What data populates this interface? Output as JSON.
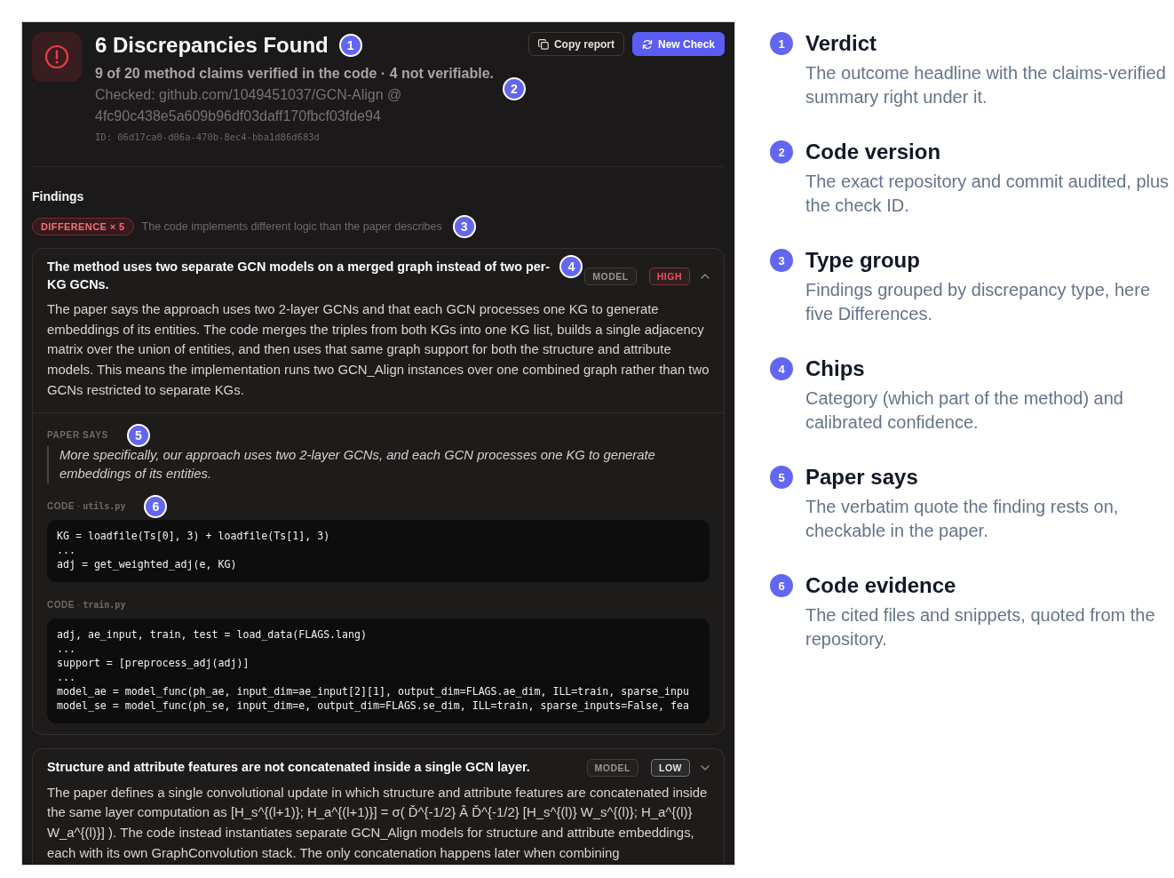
{
  "report": {
    "header": {
      "title": "6 Discrepancies Found",
      "title_callout": "1",
      "summary": "9 of 20 method claims verified in the code · 4 not verifiable.",
      "actions": [
        {
          "label": "Copy report",
          "kind": "secondary"
        },
        {
          "label": "New Check",
          "kind": "primary"
        }
      ]
    },
    "version": {
      "callout": "2",
      "checked": "Checked: github.com/1049451037/GCN-Align @ 4fc90c438e5a609b96df03daff170fbcf03fde94",
      "check_id": "ID: 06d17ca0-d06a-470b-8ec4-bba1d86d683d"
    },
    "findings_heading": "Findings",
    "groups": [
      {
        "badge": "DIFFERENCE × 5",
        "description": "The code implements different logic than the paper describes",
        "callout": "3",
        "findings": [
          {
            "title": "The method uses two separate GCN models on a merged graph instead of two per-KG GCNs.",
            "callout": "4",
            "category": "MODEL",
            "confidence": "HIGH",
            "color": "#f0525a",
            "expanded": true,
            "explanation": "The paper says the approach uses two 2-layer GCNs and that each GCN processes one KG to generate embeddings of its entities. The code merges the triples from both KGs into one KG list, builds a single adjacency matrix over the union of entities, and then uses that same graph support for both the structure and attribute models. This means the implementation runs two GCN_Align instances over one combined graph rather than two GCNs restricted to separate KGs.",
            "paper_says": {
              "label": "PAPER SAYS",
              "callout": "5",
              "quote": "More specifically, our approach uses two 2-layer GCNs, and each GCN processes one KG to generate embeddings of its entities."
            },
            "code": [
              {
                "label": "CODE",
                "separator": "·",
                "file": "utils.py",
                "callout": "6",
                "lines": [
                  "KG = loadfile(Ts[0], 3) + loadfile(Ts[1], 3)",
                  "...",
                  "adj = get_weighted_adj(e, KG)"
                ]
              },
              {
                "label": "CODE",
                "separator": "·",
                "file": "train.py",
                "lines": [
                  "adj, ae_input, train, test = load_data(FLAGS.lang)",
                  "...",
                  "support = [preprocess_adj(adj)]",
                  "...",
                  "model_ae = model_func(ph_ae, input_dim=ae_input[2][1], output_dim=FLAGS.ae_dim, ILL=train, sparse_inpu",
                  "model_se = model_func(ph_se, input_dim=e, output_dim=FLAGS.se_dim, ILL=train, sparse_inputs=False, fea"
                ]
              }
            ]
          },
          {
            "title": "Structure and attribute features are not concatenated inside a single GCN layer.",
            "category": "MODEL",
            "confidence": "LOW",
            "color": "#e4e4e7",
            "expanded": false,
            "explanation": "The paper defines a single convolutional update in which structure and attribute features are concatenated inside the same layer computation as [H_s^{(l+1)}; H_a^{(l+1)}] = σ( Ď^{-1/2} Â Ď^{-1/2} [H_s^{(l)} W_s^{(l)}; H_a^{(l)} W_a^{(l)}] ). The code instead instantiates separate GCN_Align models for structure and attribute embeddings, each with its own GraphConvolution stack. The only concatenation happens later when combining"
          }
        ]
      }
    ]
  },
  "legend": [
    {
      "number": "1",
      "title": "Verdict",
      "description": "The outcome headline with the claims-verified summary right under it."
    },
    {
      "number": "2",
      "title": "Code version",
      "description": "The exact repository and commit audited, plus the check ID."
    },
    {
      "number": "3",
      "title": "Type group",
      "description": "Findings grouped by discrepancy type, here five Differences."
    },
    {
      "number": "4",
      "title": "Chips",
      "description": "Category (which part of the method) and calibrated confidence."
    },
    {
      "number": "5",
      "title": "Paper says",
      "description": "The verbatim quote the finding rests on, checkable in the paper."
    },
    {
      "number": "6",
      "title": "Code evidence",
      "description": "The cited files and snippets, quoted from the repository."
    }
  ]
}
